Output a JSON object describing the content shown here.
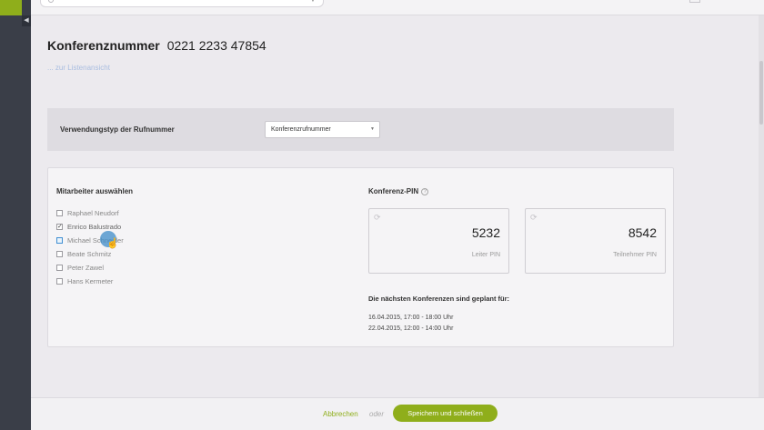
{
  "header": {
    "title_label": "Konferenznummer",
    "title_number": "0221 2233 47854",
    "back_link": "... zur Listenansicht"
  },
  "usage": {
    "label": "Verwendungstyp der Rufnummer",
    "selected": "Konferenzrufnummer"
  },
  "employees": {
    "title": "Mitarbeiter auswählen",
    "items": [
      {
        "name": "Raphael Neudorf",
        "checked": false
      },
      {
        "name": "Enrico Balustrado",
        "checked": true
      },
      {
        "name": "Michael Schneider",
        "checked": false
      },
      {
        "name": "Beate Schmitz",
        "checked": false
      },
      {
        "name": "Peter Zawel",
        "checked": false
      },
      {
        "name": "Hans Kermeter",
        "checked": false
      }
    ]
  },
  "pin": {
    "title": "Konferenz-PIN",
    "leader_value": "5232",
    "leader_label": "Leiter PIN",
    "participant_value": "8542",
    "participant_label": "Teilnehmer PIN"
  },
  "schedule": {
    "title": "Die nächsten Konferenzen sind geplant für:",
    "entries": [
      "16.04.2015, 17:00 - 18:00 Uhr",
      "22.04.2015, 12:00 - 14:00 Uhr"
    ]
  },
  "footer": {
    "cancel": "Abbrechen",
    "or": "oder",
    "save": "Speichern und schließen"
  },
  "colors": {
    "accent": "#8fae1b",
    "sidebar": "#3a3e48"
  }
}
